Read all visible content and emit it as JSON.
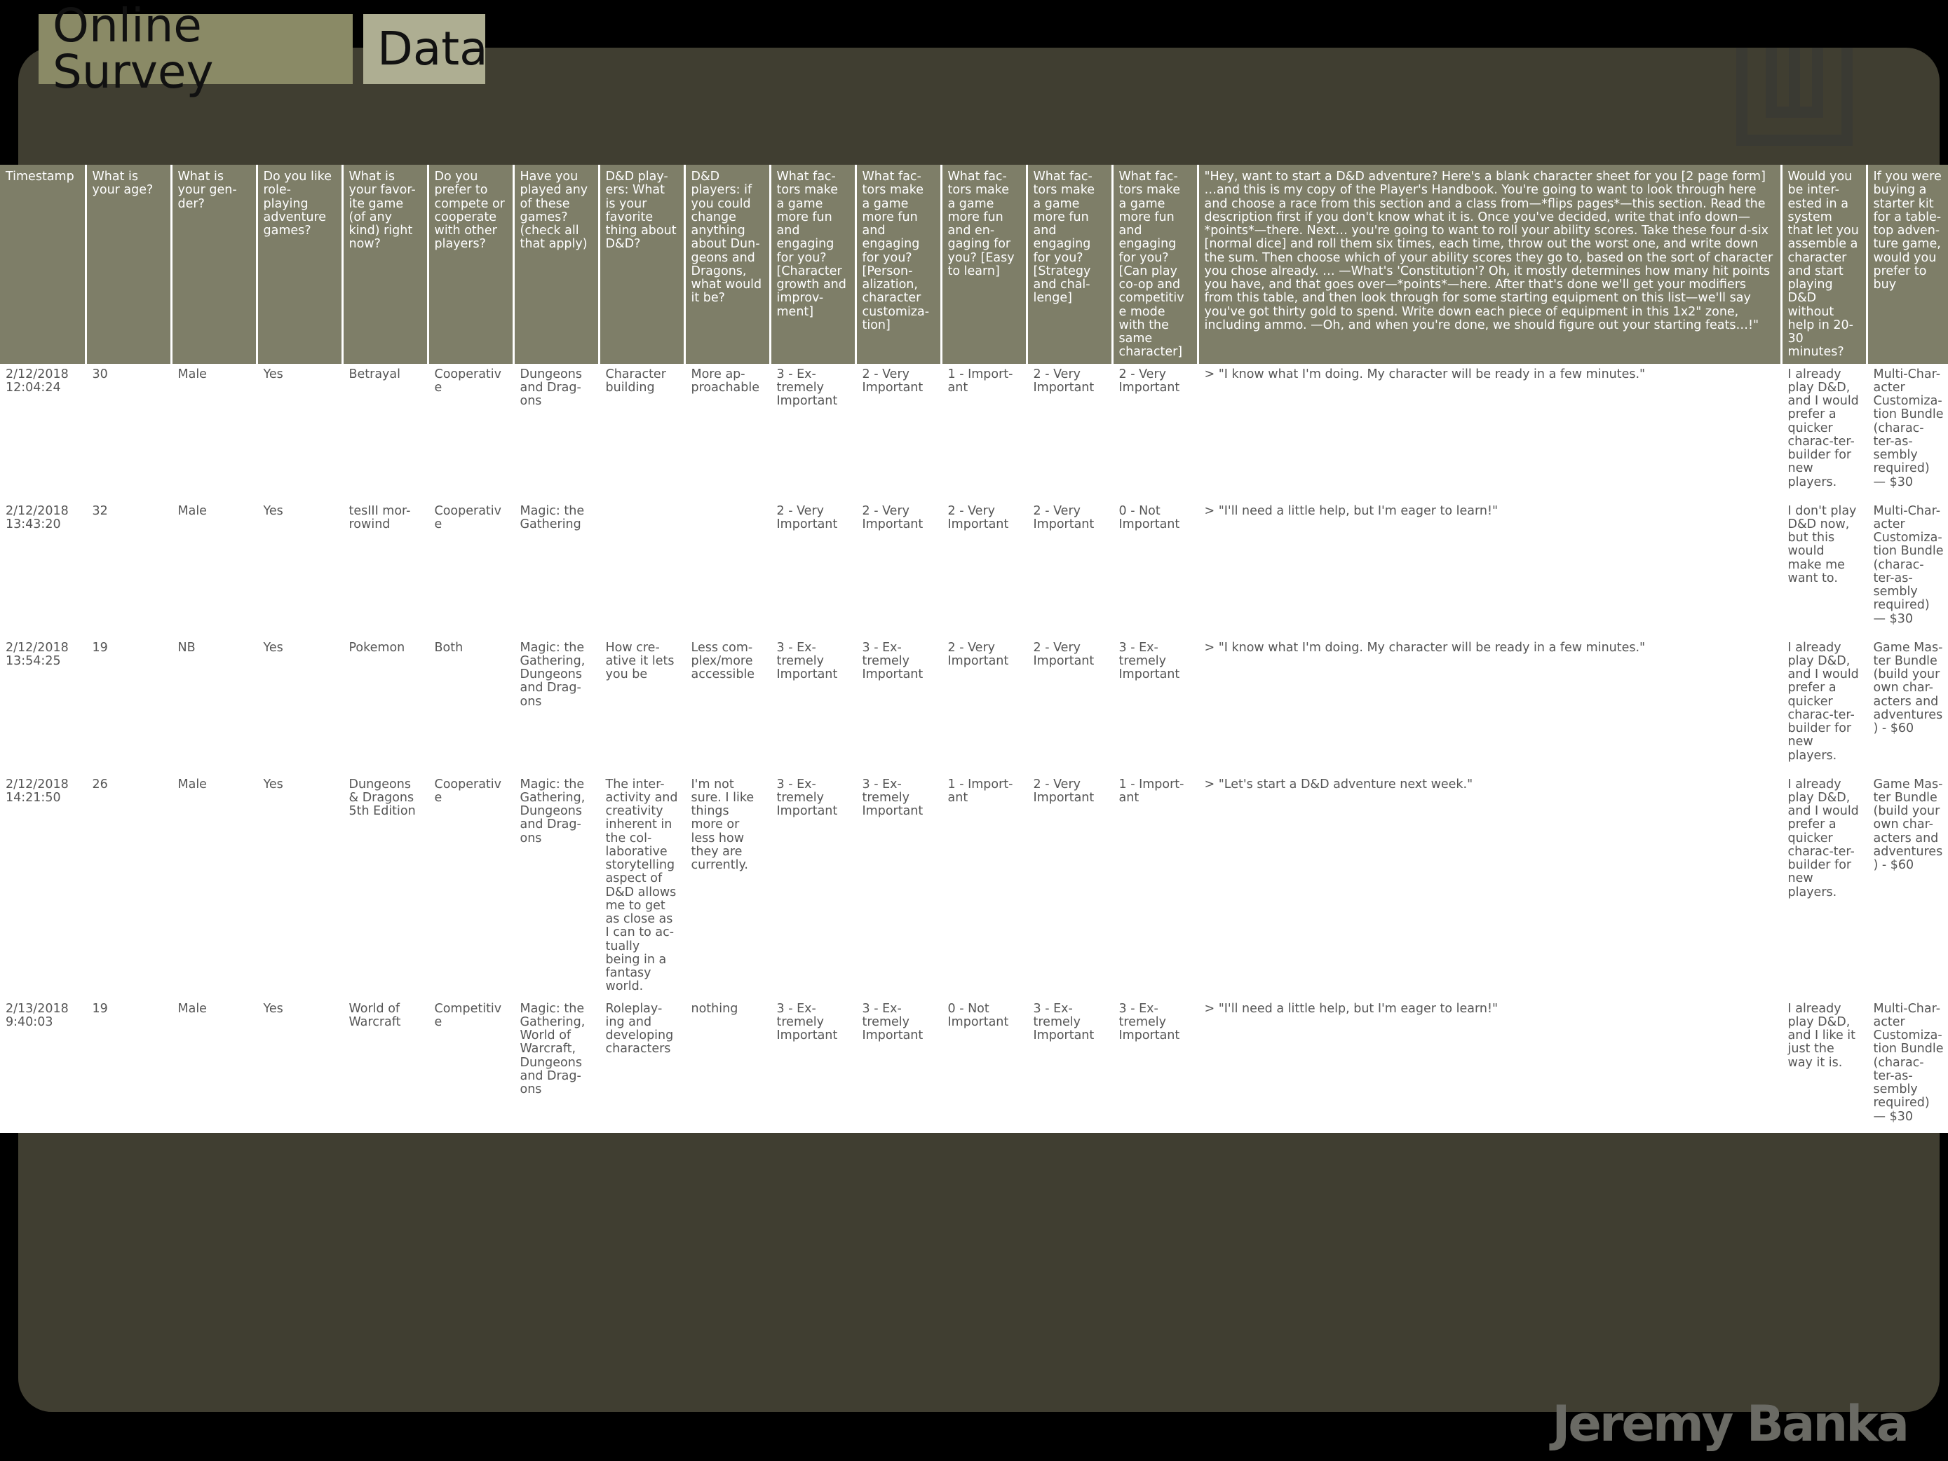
{
  "header": {
    "tab1": "Online Survey",
    "tab2": "Data"
  },
  "logo_icon": "monogram-logo-icon",
  "signature": "Jeremy Banka",
  "table": {
    "headers": [
      "Timestamp",
      "What is your age?",
      "What is your gen-der?",
      "Do you like role-playing adventure games?",
      "What is your favor-ite game (of any kind) right now?",
      "Do you prefer to compete or cooperate with other players?",
      "Have you played any of these games? (check all that apply)",
      "D&D play-ers: What is your favorite thing about D&D?",
      "D&D players: if you could change anything about Dun-geons and Dragons, what would it be?",
      "What fac-tors make a game more fun and engaging for you? [Character growth and improv-ment]",
      "What fac-tors make a game more fun and engaging for you? [Person-alization, character customiza-tion]",
      "What fac-tors make a game more fun and en-gaging for you? [Easy to learn]",
      "What fac-tors make a game more fun and engaging for you? [Strategy and chal-lenge]",
      "What fac-tors make a game more fun and engaging for you? [Can play co-op and competitive mode with the same character]",
      "\"Hey, want to start a D&D adventure? Here's a blank character sheet for you [2 page form] …and this is my copy of the Player's Handbook. You're going to want to look through here and choose a race from this section and a class from—*flips pages*—this section. Read the description first if you don't know what it is. Once you've decided, write that info down—*points*—there. Next… you're going to want to roll your ability scores. Take these four d-six [normal dice] and roll them six times, each time, throw out the worst one, and write down the sum. Then choose which of your ability scores they go to, based on the sort of character you chose already. … —What's 'Constitution'? Oh, it mostly determines how many hit points you have, and that goes over—*points*—here. After that's done we'll get your modifiers from this table, and then look through for some starting equipment on this list—we'll say you've got thirty gold to spend. Write down each piece of equipment in this 1x2\" zone, including ammo. —Oh, and when you're done, we should figure out your starting feats…!\"",
      "Would you be inter-ested in a system that let you assemble a character and start playing D&D without help in 20-30 minutes?",
      "If you were buying a starter kit for a table-top adven-ture game, would you prefer to buy"
    ],
    "rows": [
      [
        "2/12/2018 12:04:24",
        "30",
        "Male",
        "Yes",
        "Betrayal",
        "Cooperative",
        "Dungeons and Drag-ons",
        "Character building",
        "More ap-proachable",
        "3 - Ex-tremely Important",
        "2 - Very Important",
        "1 - Import-ant",
        "2 - Very Important",
        "2 - Very Important",
        "> \"I know what I'm doing. My character will be ready in a few minutes.\"",
        "I already play D&D, and I would prefer a quicker charac-ter-builder for new players.",
        "Multi-Char-acter Customiza-tion Bundle (charac-ter-as-sembly required) — $30"
      ],
      [
        "2/12/2018 13:43:20",
        "32",
        "Male",
        "Yes",
        "tesIII mor-rowind",
        "Cooperative",
        "Magic: the Gathering",
        "",
        "",
        "2 - Very Important",
        "2 - Very Important",
        "2 - Very Important",
        "2 - Very Important",
        "0 - Not Important",
        "> \"I'll need a little help, but I'm eager to learn!\"",
        "I don't play D&D now, but this would make me want to.",
        "Multi-Char-acter Customiza-tion Bundle (charac-ter-as-sembly required) — $30"
      ],
      [
        "2/12/2018 13:54:25",
        "19",
        "NB",
        "Yes",
        "Pokemon",
        "Both",
        "Magic: the Gathering, Dungeons and Drag-ons",
        "How cre-ative it lets you be",
        "Less com-plex/more accessible",
        "3 - Ex-tremely Important",
        "3 - Ex-tremely Important",
        "2 - Very Important",
        "2 - Very Important",
        "3 - Ex-tremely Important",
        "> \"I know what I'm doing. My character will be ready in a few minutes.\"",
        "I already play D&D, and I would prefer a quicker charac-ter-builder for new players.",
        "Game Mas-ter Bundle (build your own char-acters and adventures) - $60"
      ],
      [
        "2/12/2018 14:21:50",
        "26",
        "Male",
        "Yes",
        "Dungeons & Dragons 5th Edition",
        "Cooperative",
        "Magic: the Gathering, Dungeons and Drag-ons",
        "The inter-activity and creativity inherent in the col-laborative storytelling aspect of D&D allows me to get as close as I can to ac-tually being in a fantasy world.",
        "I'm not sure. I like things more or less how they are currently.",
        "3 - Ex-tremely Important",
        "3 - Ex-tremely Important",
        "1 - Import-ant",
        "2 - Very Important",
        "1 - Import-ant",
        "> \"Let's start a D&D adventure next week.\"",
        "I already play D&D, and I would prefer a quicker charac-ter-builder for new players.",
        "Game Mas-ter Bundle (build your own char-acters and adventures) - $60"
      ],
      [
        "2/13/2018 9:40:03",
        "19",
        "Male",
        "Yes",
        "World of Warcraft",
        "Competitive",
        "Magic: the Gathering, World of Warcraft, Dungeons and Drag-ons",
        "Roleplay-ing and developing characters",
        "nothing",
        "3 - Ex-tremely Important",
        "3 - Ex-tremely Important",
        "0 - Not Important",
        "3 - Ex-tremely Important",
        "3 - Ex-tremely Important",
        "> \"I'll need a little help, but I'm eager to learn!\"",
        "I already play D&D, and I like it just the way it is.",
        "Multi-Char-acter Customiza-tion Bundle (charac-ter-as-sembly required) — $30"
      ]
    ]
  }
}
